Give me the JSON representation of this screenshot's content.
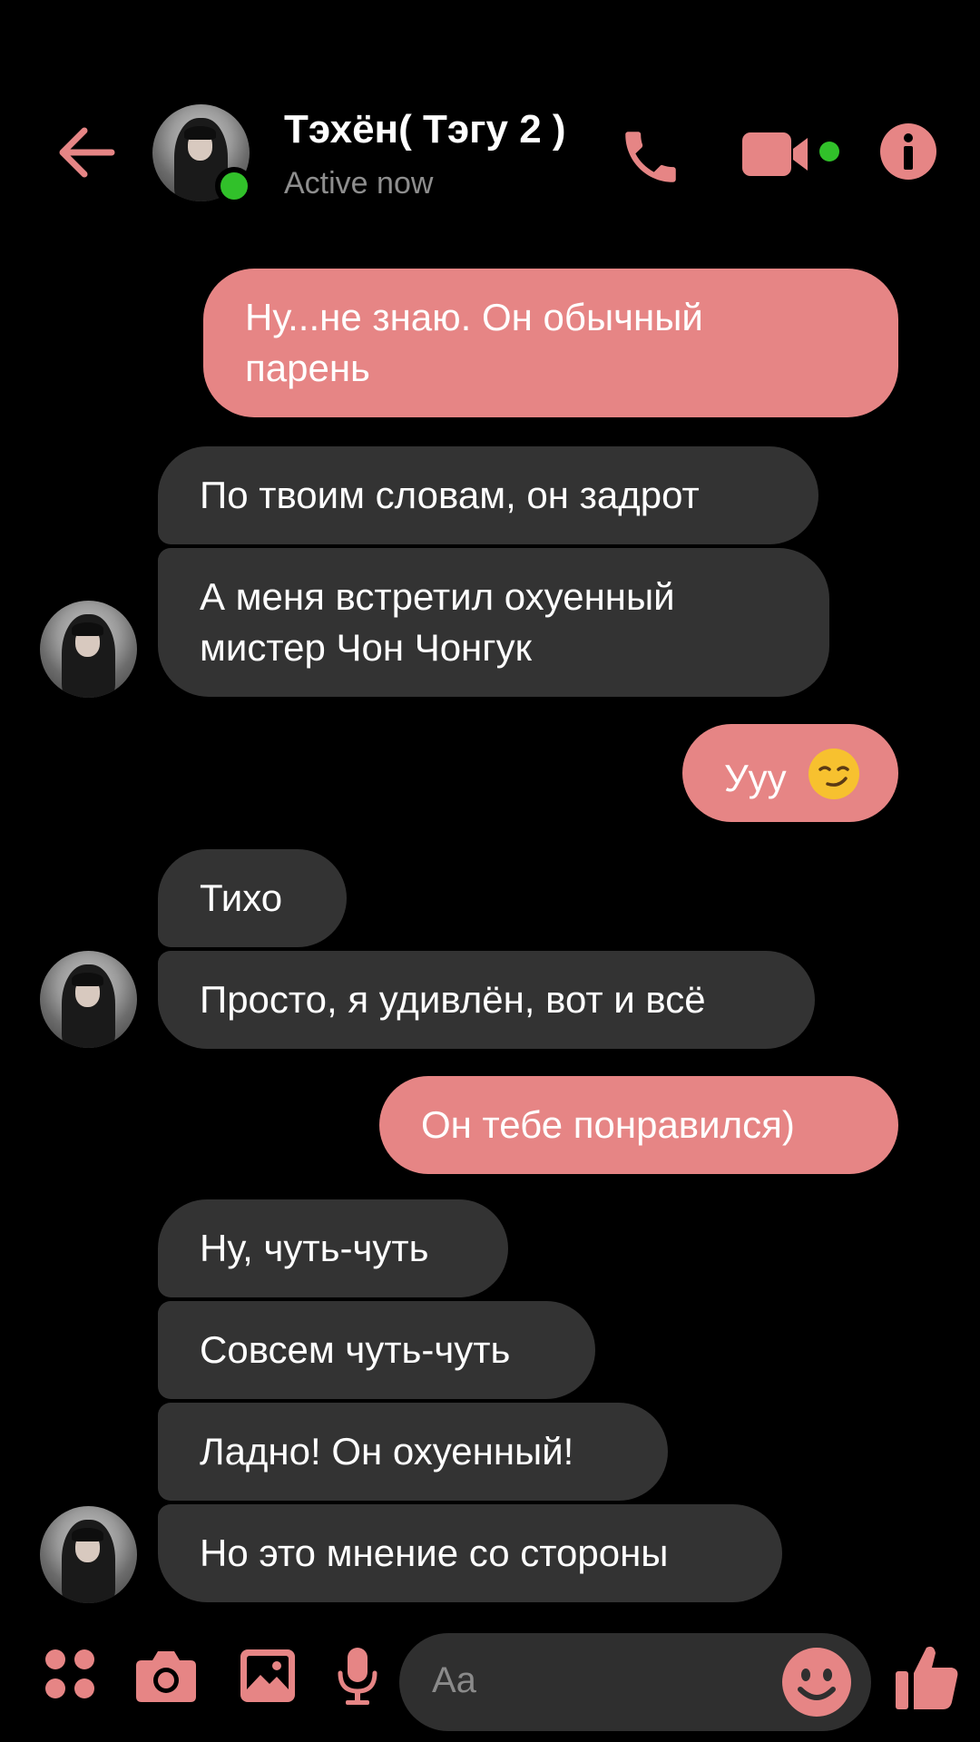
{
  "theme": {
    "accent": "#e68585",
    "incoming_bubble": "#333333",
    "background": "#000000",
    "online": "#31c12a"
  },
  "header": {
    "contact_name": "Тэхён( Тэгу 2 )",
    "status": "Active now",
    "icons": {
      "back": "back-arrow-icon",
      "phone": "phone-icon",
      "video": "video-camera-icon",
      "info": "info-icon"
    }
  },
  "messages": [
    {
      "direction": "out",
      "text_lines": [
        "Ну...не знаю. Он обычный",
        "парень"
      ]
    },
    {
      "direction": "in",
      "text_lines": [
        "По твоим словам, он задрот"
      ]
    },
    {
      "direction": "in",
      "text_lines": [
        "А меня встретил охуенный",
        "мистер Чон Чонгук"
      ]
    },
    {
      "direction": "out",
      "text_lines": [
        "Ууу"
      ],
      "emoji": "smirking-face-emoji"
    },
    {
      "direction": "in",
      "text_lines": [
        "Тихо"
      ]
    },
    {
      "direction": "in",
      "text_lines": [
        "Просто, я удивлён, вот и всё"
      ]
    },
    {
      "direction": "out",
      "text_lines": [
        "Он тебе понравился)"
      ]
    },
    {
      "direction": "in",
      "text_lines": [
        "Ну, чуть-чуть"
      ]
    },
    {
      "direction": "in",
      "text_lines": [
        "Совсем чуть-чуть"
      ]
    },
    {
      "direction": "in",
      "text_lines": [
        "Ладно! Он охуенный!"
      ]
    },
    {
      "direction": "in",
      "text_lines": [
        "Но это мнение со стороны"
      ]
    }
  ],
  "composer": {
    "placeholder": "Aa",
    "icons": {
      "more": "four-dots-menu-icon",
      "camera": "camera-icon",
      "gallery": "image-icon",
      "mic": "microphone-icon",
      "emoji": "smiley-icon",
      "like": "thumbs-up-icon"
    }
  }
}
